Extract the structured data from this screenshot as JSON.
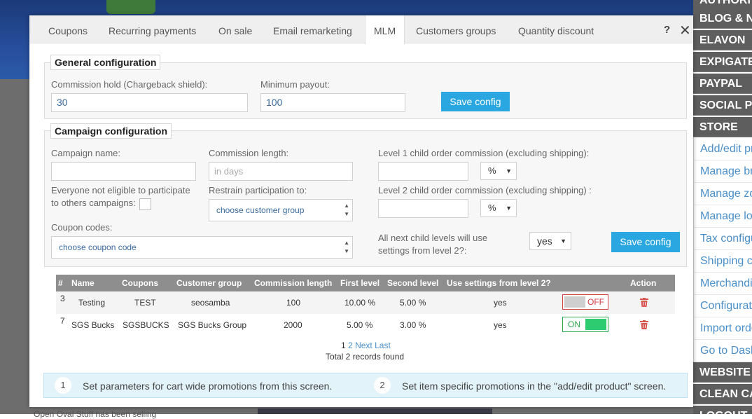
{
  "tabs": [
    {
      "label": "Coupons"
    },
    {
      "label": "Recurring payments"
    },
    {
      "label": "On sale"
    },
    {
      "label": "Email remarketing"
    },
    {
      "label": "MLM"
    },
    {
      "label": "Customers groups"
    },
    {
      "label": "Quantity discount"
    }
  ],
  "active_tab": "MLM",
  "help_label": "?",
  "close_label": "✕",
  "general": {
    "legend": "General configuration",
    "commission_hold_label": "Commission hold (Chargeback shield):",
    "commission_hold_value": "30",
    "minimum_payout_label": "Minimum payout:",
    "minimum_payout_value": "100",
    "save_label": "Save config"
  },
  "campaign": {
    "legend": "Campaign configuration",
    "name_label": "Campaign name:",
    "name_value": "",
    "length_label": "Commission length:",
    "length_placeholder": "in days",
    "level1_label": "Level 1 child order commission (excluding shipping):",
    "level1_unit": "%",
    "level2_label": "Level 2 child order commission (excluding shipping) :",
    "level2_unit": "%",
    "eligible_label_line1": "Everyone not eligible to participate",
    "eligible_label_line2": "to others campaigns:",
    "restrain_label": "Restrain participation to:",
    "restrain_value": "choose customer group",
    "coupon_label": "Coupon codes:",
    "coupon_value": "choose coupon code",
    "next_levels_label_line1": "All next child levels will use",
    "next_levels_label_line2": "settings from level 2?:",
    "next_levels_value": "yes",
    "save_label": "Save config"
  },
  "table": {
    "headers": [
      "#",
      "Name",
      "Coupons",
      "Customer group",
      "Commission length",
      "First level",
      "Second level",
      "Use settings from level 2?",
      "Action"
    ],
    "rows": [
      {
        "id": "3",
        "name": "Testing",
        "coupons": "TEST",
        "group": "seosamba",
        "length": "100",
        "first": "10.00 %",
        "second": "5.00 %",
        "use_level2": "yes",
        "toggle": "OFF"
      },
      {
        "id": "7",
        "name": "SGS Bucks",
        "coupons": "SGSBUCKS",
        "group": "SGS Bucks Group",
        "length": "2000",
        "first": "5.00 %",
        "second": "3.00 %",
        "use_level2": "yes",
        "toggle": "ON"
      }
    ]
  },
  "pager": {
    "current": "1",
    "page2": "2",
    "next": "Next",
    "last": "Last",
    "records": "Total 2 records found"
  },
  "info": [
    {
      "num": "1",
      "text": "Set parameters for cart wide promotions from this screen."
    },
    {
      "num": "2",
      "text": "Set item specific promotions in the \"add/edit product\" screen."
    }
  ],
  "sidebar": {
    "sections": [
      "AUTHORI",
      "BLOG & N",
      "ELAVON",
      "EXPIGATE",
      "PAYPAL",
      "SOCIAL P",
      "STORE"
    ],
    "links": [
      "Add/edit pr",
      "Manage br",
      "Manage zo",
      "Manage lo",
      "Tax configu",
      "Shipping c",
      "Merchandi",
      "Configurat",
      "Import orde",
      "Go to Dash"
    ],
    "bottom_sections": [
      "WEBSITE",
      "CLEAN CA",
      "LOGOUT"
    ]
  },
  "background": {
    "caption": "Open Oval Stuff has been selling"
  }
}
